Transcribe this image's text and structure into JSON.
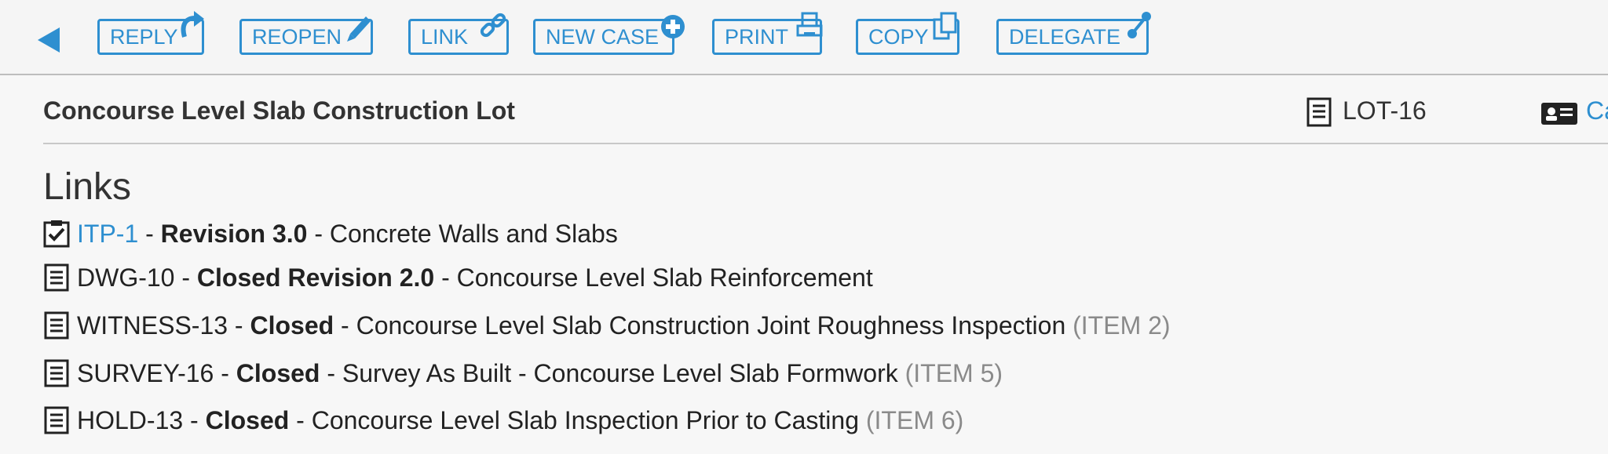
{
  "toolbar": {
    "buttons": [
      {
        "label": "REPLY",
        "icon": "reply-arrow-icon"
      },
      {
        "label": "REOPEN",
        "icon": "pencil-icon"
      },
      {
        "label": "LINK",
        "icon": "chain-link-icon"
      },
      {
        "label": "NEW CASE",
        "icon": "plus-circle-icon"
      },
      {
        "label": "PRINT",
        "icon": "printer-icon"
      },
      {
        "label": "COPY",
        "icon": "copy-icon"
      },
      {
        "label": "DELEGATE",
        "icon": "delegate-node-icon"
      }
    ],
    "accent_color": "#2e8fd0"
  },
  "case": {
    "title": "Concourse Level Slab Construction Lot",
    "lot_id": "LOT-16",
    "partial_link_text": "Ca"
  },
  "links": {
    "heading": "Links",
    "items": [
      {
        "icon": "checklist-clipboard-icon",
        "ref": "ITP-1",
        "ref_is_link": true,
        "status": "Revision 3.0",
        "description": "Concrete Walls and Slabs",
        "item": ""
      },
      {
        "icon": "document-icon",
        "ref": "DWG-10",
        "ref_is_link": false,
        "status": "Closed Revision 2.0",
        "description": "Concourse Level Slab Reinforcement",
        "item": ""
      },
      {
        "icon": "document-icon",
        "ref": "WITNESS-13",
        "ref_is_link": false,
        "status": "Closed",
        "description": "Concourse Level Slab Construction Joint Roughness Inspection",
        "item": "(ITEM 2)"
      },
      {
        "icon": "document-icon",
        "ref": "SURVEY-16",
        "ref_is_link": false,
        "status": "Closed",
        "description": "Survey As Built - Concourse Level Slab Formwork",
        "item": "(ITEM 5)"
      },
      {
        "icon": "document-icon",
        "ref": "HOLD-13",
        "ref_is_link": false,
        "status": "Closed",
        "description": "Concourse Level Slab Inspection Prior to Casting",
        "item": "(ITEM 6)"
      }
    ]
  }
}
